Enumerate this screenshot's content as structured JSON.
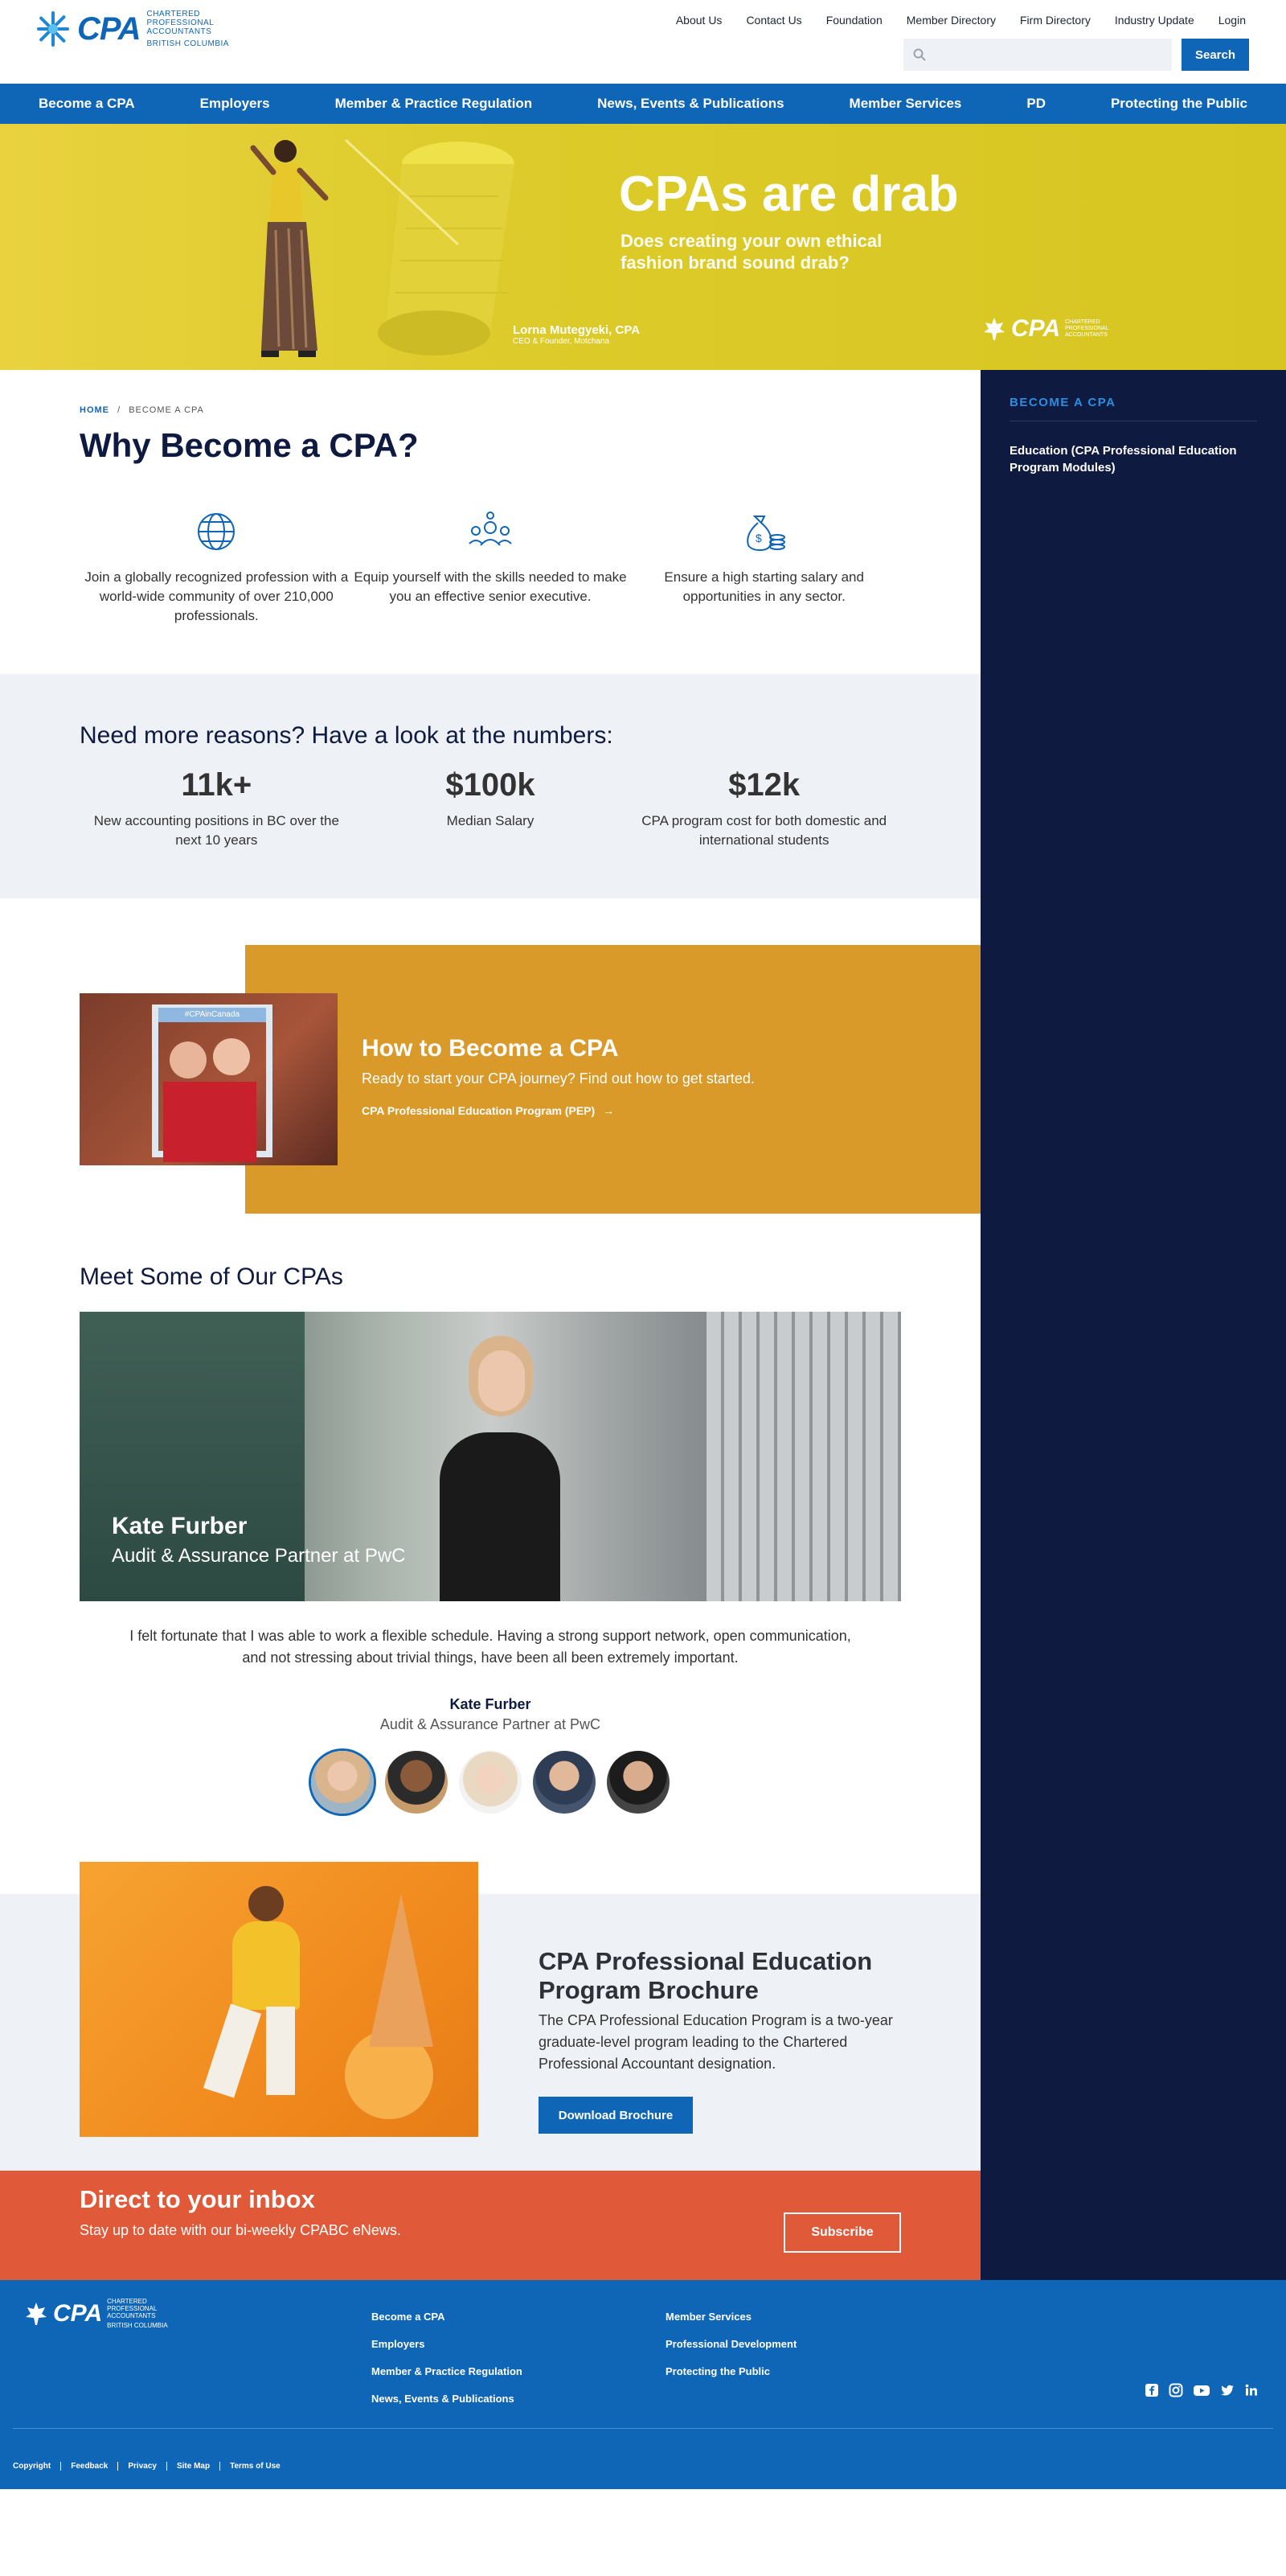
{
  "header": {
    "logo_text": "CPA",
    "logo_lines": [
      "CHARTERED",
      "PROFESSIONAL",
      "ACCOUNTANTS"
    ],
    "logo_region": "BRITISH COLUMBIA",
    "utility_links": [
      "About Us",
      "Contact Us",
      "Foundation",
      "Member Directory",
      "Firm Directory",
      "Industry Update",
      "Login"
    ],
    "search_placeholder": "",
    "search_button": "Search"
  },
  "main_nav": [
    "Become a CPA",
    "Employers",
    "Member & Practice Regulation",
    "News, Events & Publications",
    "Member Services",
    "PD",
    "Protecting the Public"
  ],
  "hero": {
    "title": "CPAs are drab",
    "subtitle": "Does creating your own ethical fashion brand sound drab?",
    "caption_name": "Lorna Mutegyeki, CPA",
    "caption_role": "CEO & Founder, Motchana",
    "logo_text": "CPA",
    "logo_sub": "CHARTERED PROFESSIONAL ACCOUNTANTS"
  },
  "breadcrumb": {
    "home": "HOME",
    "sep": "/",
    "current": "BECOME A CPA"
  },
  "page_title": "Why Become a CPA?",
  "features": [
    {
      "icon": "globe-network-icon",
      "text": "Join a globally recognized profession with a world-wide community of over 210,000 professionals."
    },
    {
      "icon": "team-skills-icon",
      "text": "Equip yourself with the skills needed to make you an effective senior executive."
    },
    {
      "icon": "money-bag-icon",
      "text": "Ensure a high starting salary and opportunities in any sector."
    }
  ],
  "numbers": {
    "heading": "Need more reasons? Have a look at the numbers:",
    "stats": [
      {
        "value": "11k+",
        "label": "New accounting positions in BC over the next 10 years"
      },
      {
        "value": "$100k",
        "label": "Median Salary"
      },
      {
        "value": "$12k",
        "label": "CPA program cost for both domestic and international students"
      }
    ]
  },
  "howto": {
    "title": "How to Become a CPA",
    "subtitle": "Ready to start your CPA journey? Find out how to get started.",
    "link": "CPA Professional Education Program (PEP)",
    "link_arrow": "→",
    "photo_sign": "#CPAinCanada"
  },
  "meet": {
    "heading": "Meet Some of Our CPAs",
    "featured_name": "Kate Furber",
    "featured_role": "Audit & Assurance Partner at PwC",
    "quote": "I felt fortunate that I was able to work a flexible schedule. Having a strong support network, open communication, and not stressing about trivial things, have been all been extremely important.",
    "quote_name": "Kate Furber",
    "quote_role": "Audit & Assurance Partner at PwC"
  },
  "brochure": {
    "title": "CPA Professional Education Program Brochure",
    "text": "The CPA Professional Education Program is a two-year graduate-level program leading to the Chartered Professional Accountant designation.",
    "button": "Download Brochure"
  },
  "inbox": {
    "title": "Direct to your inbox",
    "subtitle": "Stay up to date with our bi-weekly CPABC eNews.",
    "button": "Subscribe"
  },
  "sidebar": {
    "title": "BECOME A CPA",
    "items": [
      "Education (CPA Professional Education Program Modules)"
    ]
  },
  "footer": {
    "logo_text": "CPA",
    "logo_sub": "CHARTERED PROFESSIONAL ACCOUNTANTS",
    "logo_region": "BRITISH COLUMBIA",
    "col1": [
      "Become a CPA",
      "Employers",
      "Member & Practice Regulation",
      "News, Events & Publications"
    ],
    "col2": [
      "Member Services",
      "Professional Development",
      "Protecting the Public"
    ],
    "social": [
      "facebook-icon",
      "instagram-icon",
      "youtube-icon",
      "twitter-icon",
      "linkedin-icon"
    ],
    "legal": [
      "Copyright",
      "Feedback",
      "Privacy",
      "Site Map",
      "Terms of Use"
    ]
  },
  "colors": {
    "brand_blue": "#1066b6",
    "navy": "#0e1a40",
    "hero_yellow": "#dccb2a",
    "howto_orange": "#d99a2a",
    "inbox_orange": "#e05a3a"
  }
}
